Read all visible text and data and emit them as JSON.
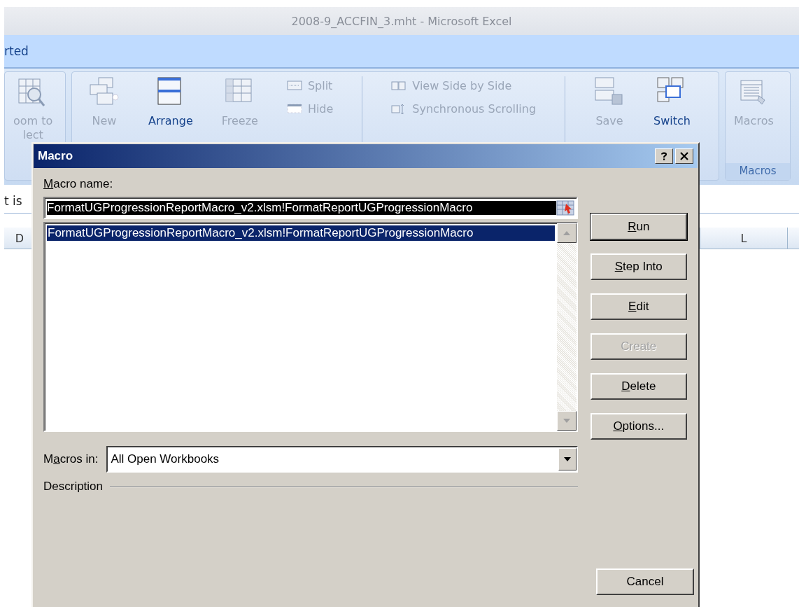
{
  "window": {
    "title": "2008-9_ACCFIN_3.mht - Microsoft Excel"
  },
  "ribbon_tab": {
    "label": "rted"
  },
  "ribbon": {
    "groups": [
      {
        "items": [
          {
            "kind": "large",
            "lines": [
              "oom to",
              "lect"
            ],
            "disabled": true
          }
        ]
      },
      {
        "items": [
          {
            "kind": "large",
            "lines": [
              "New"
            ],
            "disabled": true
          },
          {
            "kind": "large",
            "lines": [
              "Arrange"
            ],
            "disabled": false
          },
          {
            "kind": "large",
            "lines": [
              "Freeze"
            ],
            "disabled": true
          },
          {
            "kind": "stack",
            "items": [
              {
                "label": "Split",
                "disabled": true
              },
              {
                "label": "Hide",
                "disabled": true
              }
            ]
          },
          {
            "kind": "separator"
          },
          {
            "kind": "stack",
            "items": [
              {
                "label": "View Side by Side",
                "disabled": true
              },
              {
                "label": "Synchronous Scrolling",
                "disabled": true
              }
            ]
          },
          {
            "kind": "separator"
          },
          {
            "kind": "large",
            "lines": [
              "Save"
            ],
            "disabled": true
          },
          {
            "kind": "large",
            "lines": [
              "Switch"
            ],
            "disabled": false
          }
        ]
      },
      {
        "label": "Macros",
        "items": [
          {
            "kind": "large",
            "lines": [
              "Macros"
            ],
            "disabled": true
          }
        ]
      }
    ]
  },
  "formula_bar": {
    "text": "t is"
  },
  "columns": [
    "D",
    "L"
  ],
  "dialog": {
    "title": "Macro",
    "name_label": {
      "key": "M",
      "post": "acro name:"
    },
    "macro_name": "FormatUGProgressionReportMacro_v2.xlsm!FormatReportUGProgressionMacro",
    "macros": [
      {
        "name": "FormatUGProgressionReportMacro_v2.xlsm!FormatReportUGProgressionMacro",
        "selected": true
      }
    ],
    "macros_in_label": {
      "pre": "M",
      "key": "a",
      "post": "cros in:"
    },
    "macros_in": "All Open Workbooks",
    "description_label": "Description",
    "buttons": [
      {
        "label": {
          "key": "R",
          "post": "un"
        },
        "default": true,
        "disabled": false
      },
      {
        "label": {
          "key": "S",
          "post": "tep Into"
        },
        "default": false,
        "disabled": false
      },
      {
        "label": {
          "key": "E",
          "post": "dit"
        },
        "default": false,
        "disabled": false
      },
      {
        "label": {
          "pre": "Create"
        },
        "default": false,
        "disabled": true
      },
      {
        "label": {
          "key": "D",
          "post": "elete"
        },
        "default": false,
        "disabled": false
      },
      {
        "label": {
          "key": "O",
          "post": "ptions..."
        },
        "default": false,
        "disabled": false
      }
    ],
    "cancel": {
      "label": "Cancel"
    }
  }
}
